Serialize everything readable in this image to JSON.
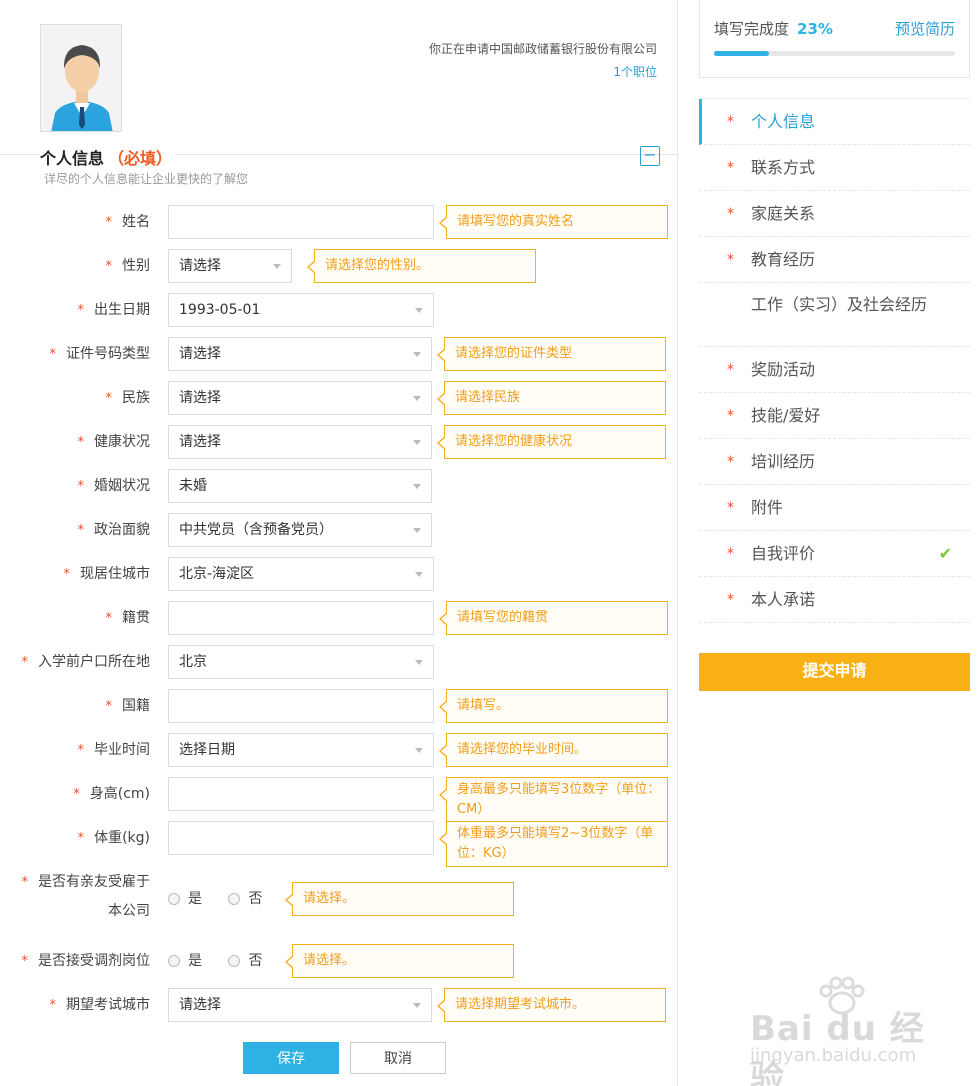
{
  "header": {
    "applying_text": "你正在申请中国邮政储蓄银行股份有限公司",
    "positions_link": "1个职位"
  },
  "section": {
    "title": "个人信息",
    "required": "（必填）",
    "collapse": "−",
    "subtitle": "详尽的个人信息能让企业更快的了解您"
  },
  "form": {
    "name": {
      "label": "姓名",
      "value": "",
      "tip": "请填写您的真实姓名"
    },
    "gender": {
      "label": "性别",
      "value": "请选择",
      "tip": "请选择您的性别。"
    },
    "birth": {
      "label": "出生日期",
      "value": "1993-05-01"
    },
    "id_type": {
      "label": "证件号码类型",
      "value": "请选择",
      "tip": "请选择您的证件类型"
    },
    "ethnicity": {
      "label": "民族",
      "value": "请选择",
      "tip": "请选择民族"
    },
    "health": {
      "label": "健康状况",
      "value": "请选择",
      "tip": "请选择您的健康状况"
    },
    "marital": {
      "label": "婚姻状况",
      "value": "未婚"
    },
    "political": {
      "label": "政治面貌",
      "value": "中共党员（含预备党员）"
    },
    "city": {
      "label": "现居住城市",
      "value": "北京-海淀区"
    },
    "native": {
      "label": "籍贯",
      "value": "",
      "tip": "请填写您的籍贯"
    },
    "hukou": {
      "label": "入学前户口所在地",
      "value": "北京"
    },
    "nationality": {
      "label": "国籍",
      "value": "",
      "tip": "请填写。"
    },
    "graduation": {
      "label": "毕业时间",
      "value": "选择日期",
      "tip": "请选择您的毕业时间。"
    },
    "height": {
      "label": "身高(cm)",
      "value": "",
      "tip": "身高最多只能填写3位数字（单位：CM）"
    },
    "weight": {
      "label": "体重(kg)",
      "value": "",
      "tip": "体重最多只能填写2~3位数字（单位：KG）"
    },
    "relatives": {
      "label_line1": "是否有亲友受雇于",
      "label_line2": "本公司",
      "yes": "是",
      "no": "否",
      "tip": "请选择。"
    },
    "adjust": {
      "label": "是否接受调剂岗位",
      "yes": "是",
      "no": "否",
      "tip": "请选择。"
    },
    "exam_city": {
      "label": "期望考试城市",
      "value": "请选择",
      "tip": "请选择期望考试城市。"
    },
    "star": "*"
  },
  "buttons": {
    "save": "保存",
    "cancel": "取消",
    "submit": "提交申请"
  },
  "progress": {
    "label": "填写完成度",
    "percent_text": "23%",
    "percent": 0.23,
    "preview": "预览简历"
  },
  "nav": [
    {
      "label": "个人信息",
      "star": "*",
      "active": true
    },
    {
      "label": "联系方式",
      "star": "*"
    },
    {
      "label": "家庭关系",
      "star": "*"
    },
    {
      "label": "教育经历",
      "star": "*"
    },
    {
      "label": "工作（实习）及社会经历",
      "star": ""
    },
    {
      "label": "奖励活动",
      "star": "*"
    },
    {
      "label": "技能/爱好",
      "star": "*"
    },
    {
      "label": "培训经历",
      "star": "*"
    },
    {
      "label": "附件",
      "star": "*"
    },
    {
      "label": "自我评价",
      "star": "*",
      "check": "✔"
    },
    {
      "label": "本人承诺",
      "star": "*"
    }
  ],
  "watermark": {
    "text": "Bai du 经验",
    "url": "jingyan.baidu.com"
  },
  "colors": {
    "accent": "#2eb2e6",
    "warning": "#f5b01f",
    "required": "#e8502b",
    "submit": "#f9b115"
  }
}
